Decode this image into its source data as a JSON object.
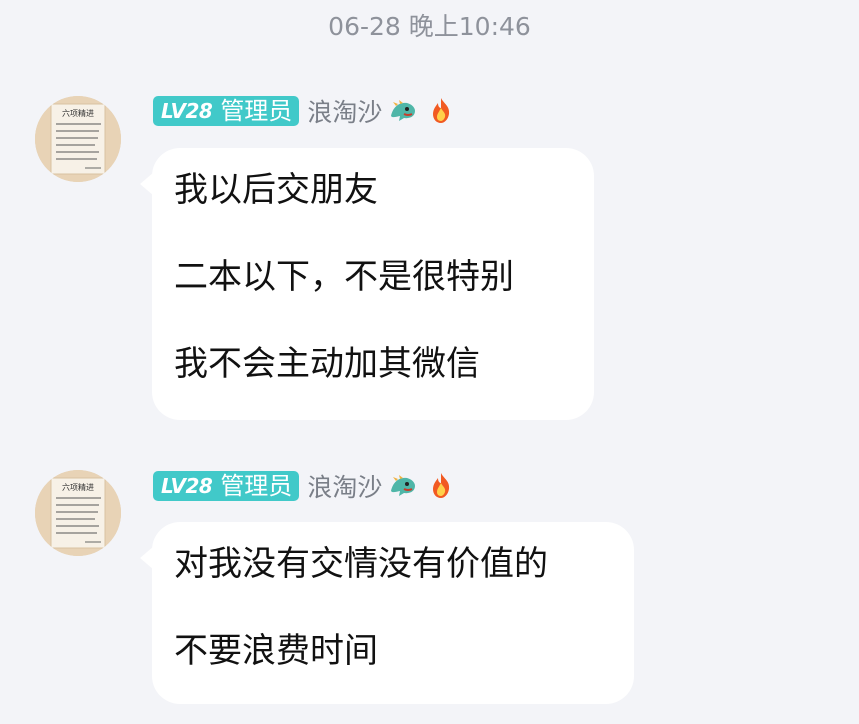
{
  "timestamp": "06-28 晚上10:46",
  "messages": [
    {
      "sender": {
        "level": "LV28",
        "role": "管理员",
        "name": "浪淘沙",
        "icons": [
          "dragon-icon",
          "fire-icon"
        ]
      },
      "avatar": {
        "title": "六项精进"
      },
      "lines": [
        "我以后交朋友",
        "二本以下，不是很特别",
        "我不会主动加其微信"
      ]
    },
    {
      "sender": {
        "level": "LV28",
        "role": "管理员",
        "name": "浪淘沙",
        "icons": [
          "dragon-icon",
          "fire-icon"
        ]
      },
      "avatar": {
        "title": "六项精进"
      },
      "lines": [
        "对我没有交情没有价值的",
        "不要浪费时间"
      ]
    }
  ],
  "colors": {
    "background": "#f3f4f8",
    "bubble": "#ffffff",
    "badge": "#41c9c9",
    "timestamp": "#8e929b",
    "name": "#7a7f88"
  }
}
